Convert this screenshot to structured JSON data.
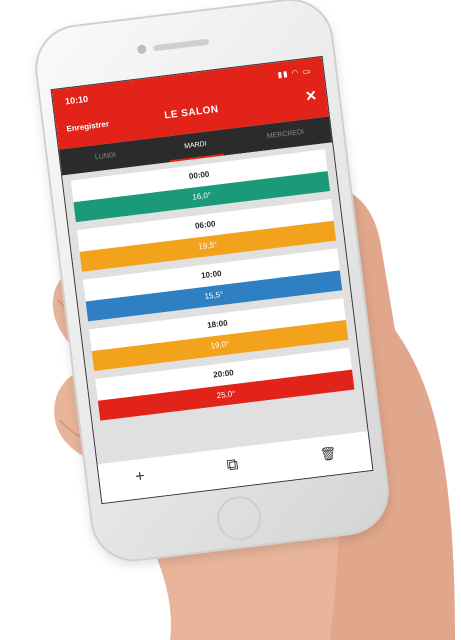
{
  "status_bar": {
    "time": "10:10",
    "icons": "▮▮ ◠ ▭"
  },
  "header": {
    "save_label": "Enregistrer",
    "title": "LE SALON",
    "close_icon": "×"
  },
  "tabs": [
    {
      "label": "LUNDI",
      "active": false
    },
    {
      "label": "MARDI",
      "active": true
    },
    {
      "label": "MERCREDI",
      "active": false
    }
  ],
  "schedule": [
    {
      "time": "00:00",
      "temp": "16,0°",
      "color": "#1a9a78"
    },
    {
      "time": "06:00",
      "temp": "19,5°",
      "color": "#f2a21b"
    },
    {
      "time": "10:00",
      "temp": "15,5°",
      "color": "#2f7fc3"
    },
    {
      "time": "18:00",
      "temp": "19,0°",
      "color": "#f2a21b"
    },
    {
      "time": "20:00",
      "temp": "25,0°",
      "color": "#e2231a"
    }
  ],
  "bottom_bar": {
    "add_icon": "+",
    "copy_icon": "⧉",
    "delete_icon": "🗑"
  }
}
